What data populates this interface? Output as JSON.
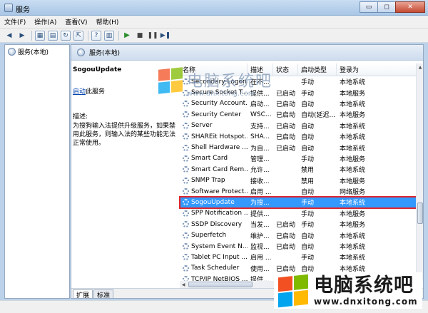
{
  "window": {
    "title": "服务",
    "minimize": "▭",
    "restore": "◻",
    "close": "✕"
  },
  "menu": [
    "文件(F)",
    "操作(A)",
    "查看(V)",
    "帮助(H)"
  ],
  "toolbar": {
    "icons": [
      "back-arrow-icon",
      "forward-arrow-icon",
      "show-console-tree-icon",
      "properties-icon",
      "refresh-icon",
      "export-list-icon",
      "help-icon",
      "start-service-icon",
      "stop-service-icon",
      "pause-service-icon",
      "restart-service-icon"
    ]
  },
  "tree": {
    "root": "服务(本地)"
  },
  "panel": {
    "header": "服务(本地)",
    "selected_service": "SogouUpdate",
    "action_link": "启动",
    "action_suffix": "此服务",
    "desc_label": "描述:",
    "desc_text": "为搜狗输入法提供升级服务，如果禁用此服务，则输入法的某些功能无法正常使用。"
  },
  "table": {
    "columns": [
      "名称",
      "描述",
      "状态",
      "启动类型",
      "登录为"
    ],
    "rows": [
      {
        "name": "Secondary Logon",
        "desc": "在不...",
        "status": "",
        "start": "手动",
        "logon": "本地系统"
      },
      {
        "name": "Secure Socket T...",
        "desc": "提供...",
        "status": "已启动",
        "start": "手动",
        "logon": "本地服务"
      },
      {
        "name": "Security Account...",
        "desc": "启动...",
        "status": "已启动",
        "start": "自动",
        "logon": "本地系统"
      },
      {
        "name": "Security Center",
        "desc": "WSC...",
        "status": "已启动",
        "start": "自动(延迟...",
        "logon": "本地服务"
      },
      {
        "name": "Server",
        "desc": "支持...",
        "status": "已启动",
        "start": "自动",
        "logon": "本地系统"
      },
      {
        "name": "SHAREit Hotspot...",
        "desc": "SHA...",
        "status": "已启动",
        "start": "自动",
        "logon": "本地系统"
      },
      {
        "name": "Shell Hardware ...",
        "desc": "为自...",
        "status": "已启动",
        "start": "自动",
        "logon": "本地系统"
      },
      {
        "name": "Smart Card",
        "desc": "管理...",
        "status": "",
        "start": "手动",
        "logon": "本地服务"
      },
      {
        "name": "Smart Card Rem...",
        "desc": "允许...",
        "status": "",
        "start": "禁用",
        "logon": "本地系统"
      },
      {
        "name": "SNMP Trap",
        "desc": "接收...",
        "status": "",
        "start": "禁用",
        "logon": "本地服务"
      },
      {
        "name": "Software Protect...",
        "desc": "启用 ...",
        "status": "",
        "start": "自动",
        "logon": "网络服务"
      },
      {
        "name": "SogouUpdate",
        "desc": "为搜...",
        "status": "",
        "start": "手动",
        "logon": "本地系统",
        "selected": true
      },
      {
        "name": "SPP Notification ...",
        "desc": "提供...",
        "status": "",
        "start": "手动",
        "logon": "本地服务"
      },
      {
        "name": "SSDP Discovery",
        "desc": "当发...",
        "status": "已启动",
        "start": "手动",
        "logon": "本地服务"
      },
      {
        "name": "Superfetch",
        "desc": "维护...",
        "status": "已启动",
        "start": "自动",
        "logon": "本地系统"
      },
      {
        "name": "System Event N...",
        "desc": "监视...",
        "status": "已启动",
        "start": "自动",
        "logon": "本地系统"
      },
      {
        "name": "Tablet PC Input ...",
        "desc": "启用 ...",
        "status": "",
        "start": "手动",
        "logon": "本地系统"
      },
      {
        "name": "Task Scheduler",
        "desc": "使用...",
        "status": "已启动",
        "start": "自动",
        "logon": "本地系统"
      },
      {
        "name": "TCP/IP NetBIOS ...",
        "desc": "提供...",
        "status": "已启动",
        "start": "自动",
        "logon": "本地服务"
      }
    ]
  },
  "tabs": [
    "扩展",
    "标准"
  ],
  "watermark": {
    "cn": "电脑系统吧",
    "url": "www.dnxitong.com"
  }
}
